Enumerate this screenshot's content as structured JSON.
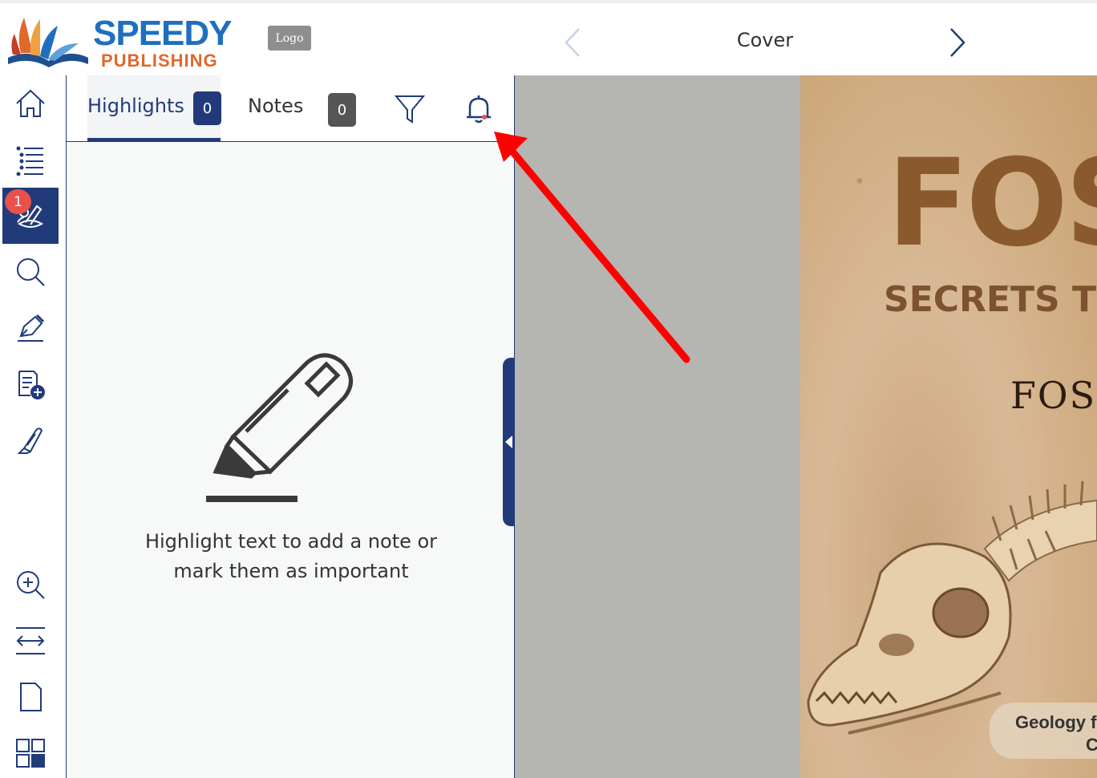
{
  "header": {
    "brand_line1": "SPEEDY",
    "brand_line2": "PUBLISHING",
    "logo_badge": "Logo",
    "page_title": "Cover"
  },
  "toolbar": {
    "items": [
      {
        "name": "home-icon"
      },
      {
        "name": "table-of-contents-icon"
      },
      {
        "name": "highlights-notes-icon",
        "badge": "1",
        "active": true
      },
      {
        "name": "search-icon"
      },
      {
        "name": "pen-annotate-icon"
      },
      {
        "name": "add-page-note-icon"
      },
      {
        "name": "highlighter-icon"
      },
      {
        "name": "zoom-in-icon"
      },
      {
        "name": "fit-width-icon"
      },
      {
        "name": "single-page-icon"
      },
      {
        "name": "grid-view-icon"
      }
    ]
  },
  "panel": {
    "tabs": [
      {
        "label": "Highlights",
        "count": "0",
        "active": true
      },
      {
        "label": "Notes",
        "count": "0",
        "active": false
      }
    ],
    "empty_message_line1": "Highlight text to add a note or",
    "empty_message_line2": "mark them as important"
  },
  "cover": {
    "title": "FOS",
    "subtitle": "SECRETS TO",
    "word": "FOSS",
    "footer_line1": "Geology f",
    "footer_line2": "C"
  },
  "colors": {
    "accent": "#213b7a",
    "badge_red": "#e8524a",
    "annotation_arrow": "#ff0000",
    "brand_blue": "#1f6fbf",
    "brand_orange": "#e0682a"
  }
}
